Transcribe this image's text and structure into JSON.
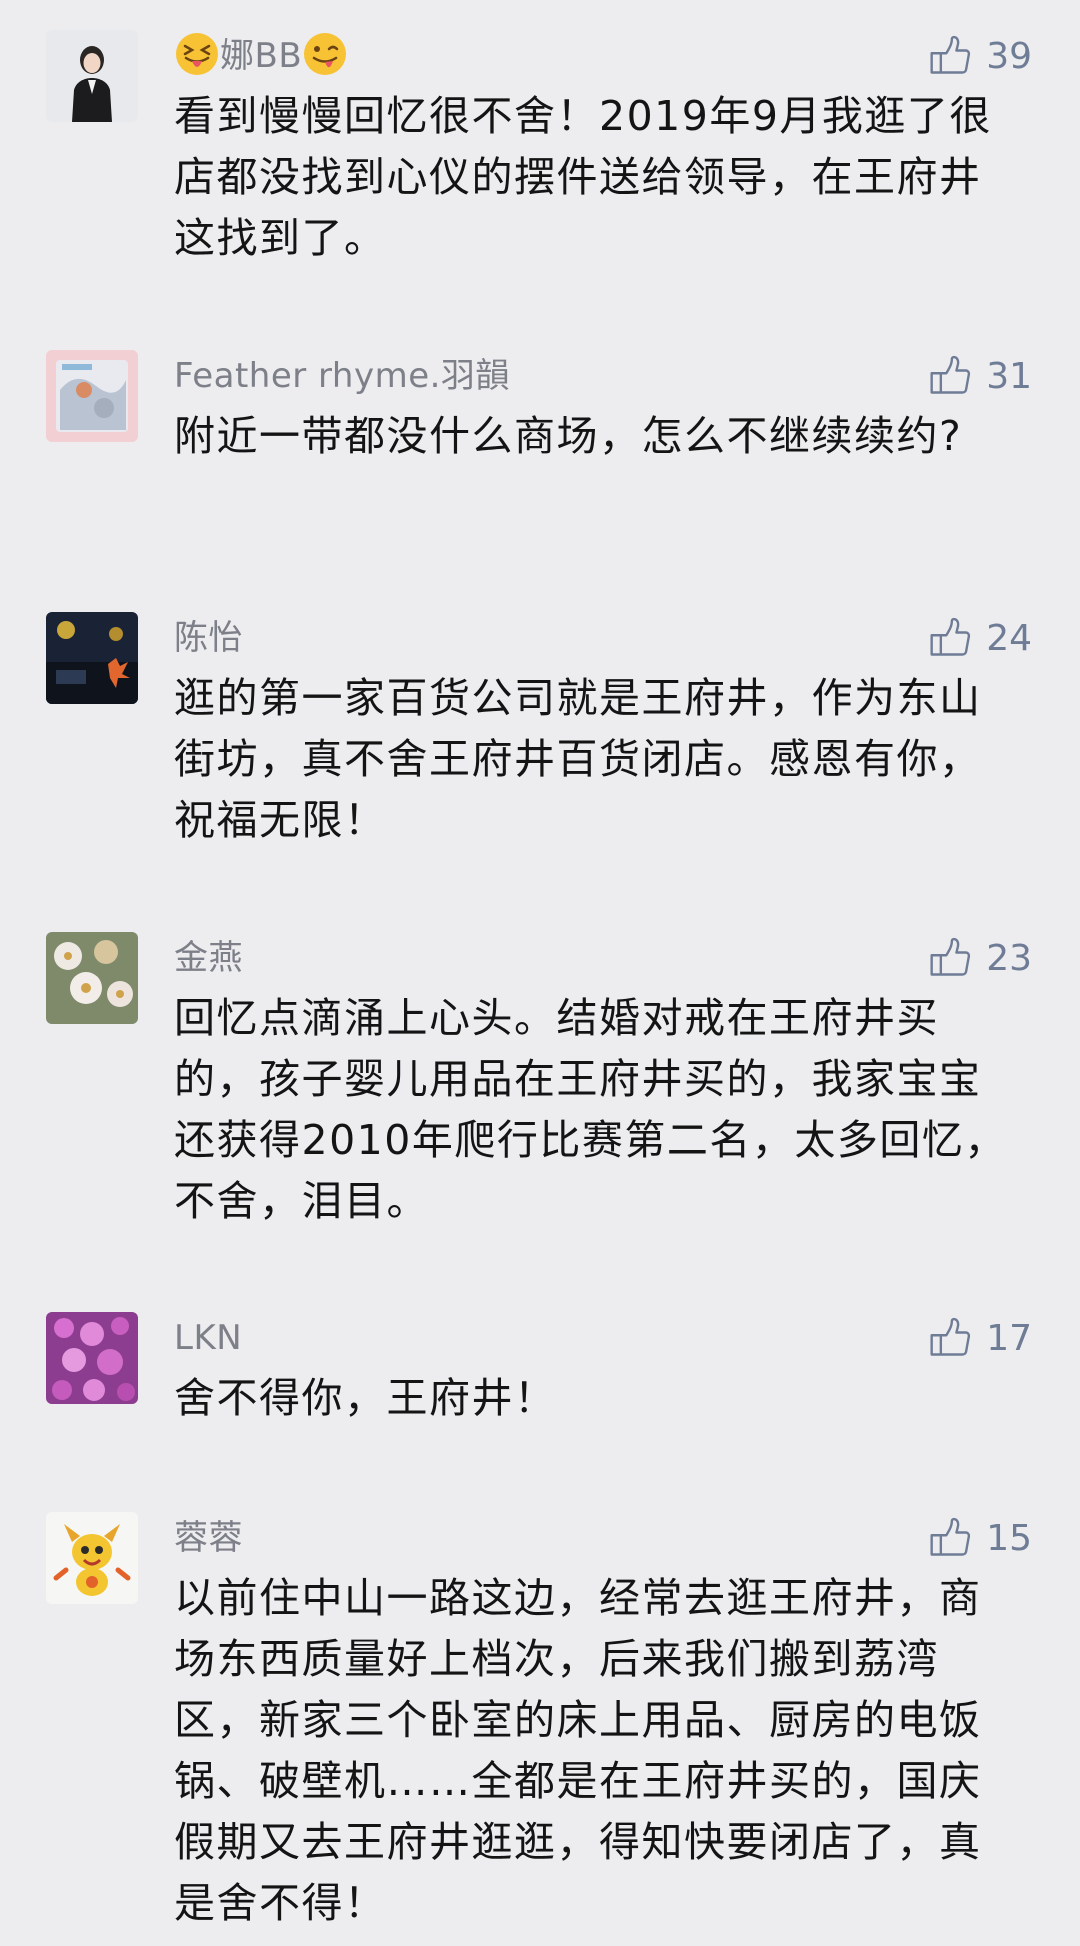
{
  "comments": [
    {
      "name": "娜BB",
      "likes": "39",
      "text": "看到慢慢回忆很不舍！2019年9月我逛了很店都没找到心仪的摆件送给领导，在王府井这找到了。"
    },
    {
      "name": "Feather rhyme.羽韻",
      "likes": "31",
      "text": "附近一带都没什么商场，怎么不继续续约?"
    },
    {
      "name": "陈怡",
      "likes": "24",
      "text": "逛的第一家百货公司就是王府井，作为东山街坊，真不舍王府井百货闭店。感恩有你，祝福无限！"
    },
    {
      "name": "金燕",
      "likes": "23",
      "text": "回忆点滴涌上心头。结婚对戒在王府井买的，孩子婴儿用品在王府井买的，我家宝宝还获得2010年爬行比赛第二名，太多回忆，不舍，泪目。"
    },
    {
      "name": "LKN",
      "likes": "17",
      "text": "舍不得你，王府井！"
    },
    {
      "name": "蓉蓉",
      "likes": "15",
      "text": "以前住中山一路这边，经常去逛王府井，商场东西质量好上档次，后来我们搬到荔湾区，新家三个卧室的床上用品、厨房的电饭锅、破壁机……全都是在王府井买的，国庆假期又去王府井逛逛，得知快要闭店了，真是舍不得！"
    }
  ],
  "colors": {
    "background": "#ededf0",
    "name": "#7e8089",
    "like": "#6f7c95",
    "text": "#141414"
  },
  "icons": {
    "like": "thumbs-up-icon",
    "emoji_left": "squinting-tongue-emoji",
    "emoji_right": "winking-tongue-emoji"
  }
}
